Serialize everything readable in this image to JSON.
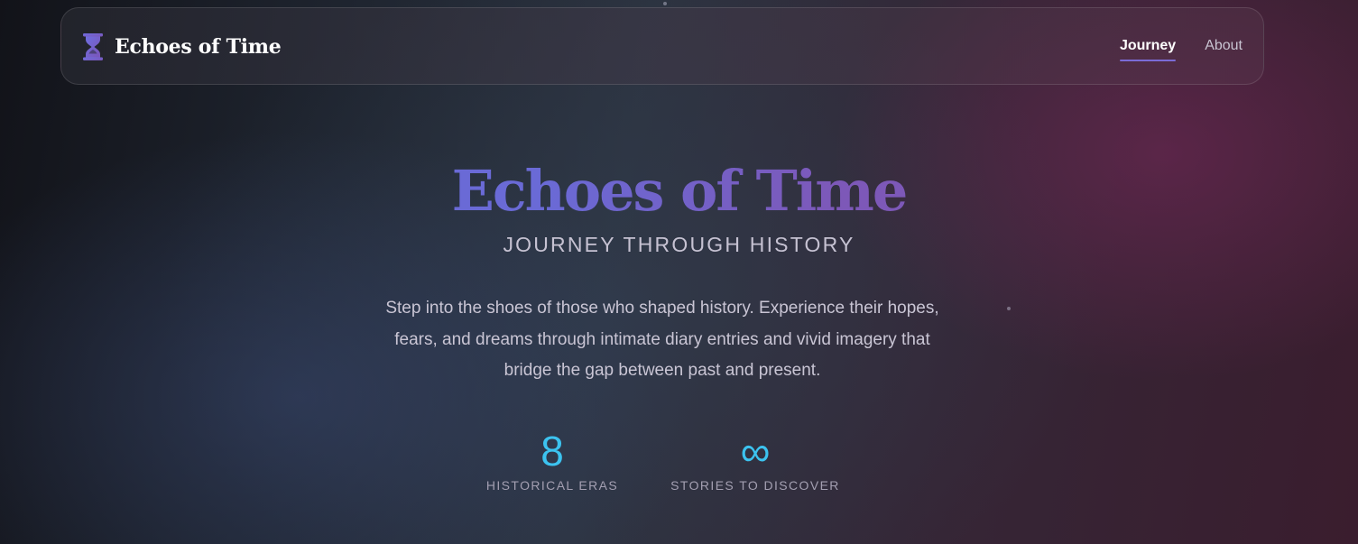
{
  "navbar": {
    "brand_icon": "hourglass-icon",
    "brand_name": "Echoes of Time",
    "links": [
      {
        "label": "Journey",
        "active": true
      },
      {
        "label": "About",
        "active": false
      }
    ],
    "accent_color": "#7b6bd6"
  },
  "hero": {
    "title": "Echoes of Time",
    "subtitle": "JOURNEY THROUGH HISTORY",
    "description": "Step into the shoes of those who shaped history. Experience their hopes, fears, and dreams through intimate diary entries and vivid imagery that bridge the gap between past and present.",
    "title_gradient": [
      "#6a6ad6",
      "#7d58b8"
    ]
  },
  "stats": [
    {
      "value": "8",
      "label": "HISTORICAL ERAS"
    },
    {
      "value": "∞",
      "label": "STORIES TO DISCOVER"
    }
  ],
  "colors": {
    "stat_value": "#3cc3f0",
    "background_left": "#121319",
    "background_right": "#3a1d2e"
  }
}
